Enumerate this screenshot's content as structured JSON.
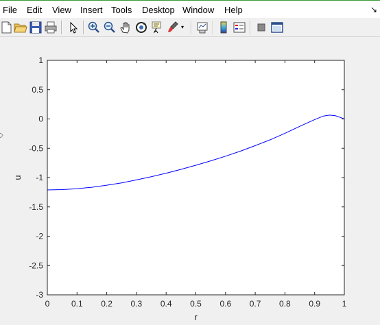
{
  "menubar": {
    "items": [
      "File",
      "Edit",
      "View",
      "Insert",
      "Tools",
      "Desktop",
      "Window",
      "Help"
    ],
    "right_arrow_icon": "dock-arrow-icon"
  },
  "toolbar": {
    "icons": [
      "new-figure-icon",
      "open-icon",
      "save-icon",
      "print-icon",
      "edit-plot-arrow-icon",
      "zoom-in-icon",
      "zoom-out-icon",
      "pan-hand-icon",
      "rotate-3d-icon",
      "data-cursor-icon",
      "brush-icon",
      "link-plot-icon",
      "colorbar-icon",
      "legend-icon",
      "hide-plot-tools-icon",
      "show-plot-tools-icon"
    ]
  },
  "chart_data": {
    "type": "line",
    "title": "",
    "xlabel": "r",
    "ylabel": "u",
    "xlim": [
      0,
      1
    ],
    "ylim": [
      -3,
      1
    ],
    "xticks": [
      0,
      0.1,
      0.2,
      0.3,
      0.4,
      0.5,
      0.6,
      0.7,
      0.8,
      0.9,
      1
    ],
    "xtick_labels": [
      "0",
      "0.1",
      "0.2",
      "0.3",
      "0.4",
      "0.5",
      "0.6",
      "0.7",
      "0.8",
      "0.9",
      "1"
    ],
    "yticks": [
      -3,
      -2.5,
      -2,
      -1.5,
      -1,
      -0.5,
      0,
      0.5,
      1
    ],
    "ytick_labels": [
      "-3",
      "-2.5",
      "-2",
      "-1.5",
      "-1",
      "-0.5",
      "0",
      "0.5",
      "1"
    ],
    "grid": false,
    "line_color": "#0000ff",
    "series": [
      {
        "x": [
          0,
          0.05,
          0.1,
          0.15,
          0.2,
          0.25,
          0.3,
          0.35,
          0.4,
          0.45,
          0.5,
          0.55,
          0.6,
          0.65,
          0.7,
          0.75,
          0.8,
          0.85,
          0.9,
          0.93,
          0.95,
          0.97,
          0.99,
          1.0
        ],
        "values": [
          -1.21,
          -1.205,
          -1.19,
          -1.165,
          -1.13,
          -1.09,
          -1.04,
          -0.985,
          -0.925,
          -0.86,
          -0.79,
          -0.715,
          -0.635,
          -0.55,
          -0.455,
          -0.355,
          -0.245,
          -0.125,
          -0.01,
          0.05,
          0.065,
          0.055,
          0.02,
          0.0
        ]
      }
    ]
  }
}
